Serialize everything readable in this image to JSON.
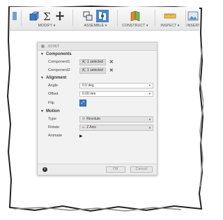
{
  "toolbar": {
    "groups": [
      {
        "label": "MODIFY ▾",
        "icons": [
          "push-pull-icon",
          "sum-icon",
          "move-icon"
        ]
      },
      {
        "label": "ASSEMBLE ▾",
        "icons": [
          "new-component-icon",
          "joint-icon"
        ]
      },
      {
        "label": "CONSTRUCT ▾",
        "icons": [
          "plane-icon"
        ]
      },
      {
        "label": "INSPECT ▾",
        "icons": [
          "measure-icon"
        ]
      },
      {
        "label": "INSERT",
        "icons": [
          "insert-image-icon"
        ]
      }
    ]
  },
  "dialog": {
    "title": "JOINT",
    "components": {
      "heading": "Components",
      "component1_label": "Component1",
      "component1_value": "1 selected",
      "component2_label": "Component2",
      "component2_value": "1 selected"
    },
    "alignment": {
      "heading": "Alignment",
      "angle_label": "Angle",
      "angle_value": "0.0 deg",
      "offset_label": "Offset",
      "offset_value": "0.00 mm",
      "flip_label": "Flip"
    },
    "motion": {
      "heading": "Motion",
      "type_label": "Type",
      "type_value": "Revolute",
      "rotate_label": "Rotate",
      "rotate_value": "Z Axis",
      "animate_label": "Animate"
    },
    "footer": {
      "ok_label": "OK",
      "cancel_label": "Cancel"
    }
  },
  "colors": {
    "accent": "#3a78c2",
    "active_tool": "#4a86c8"
  }
}
